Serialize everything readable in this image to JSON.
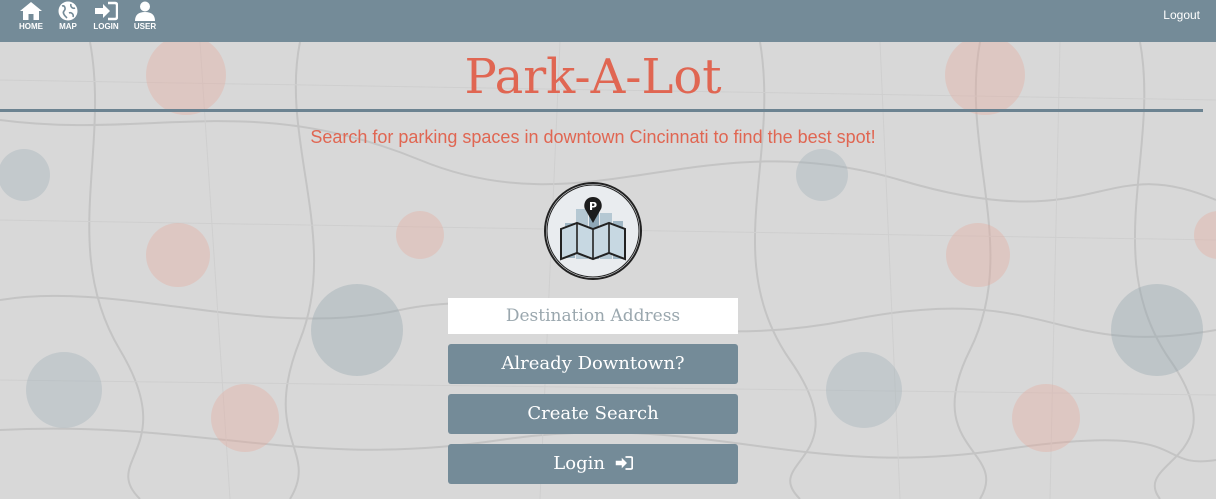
{
  "nav": {
    "items": [
      {
        "label": "HOME",
        "icon": "home-icon"
      },
      {
        "label": "MAP",
        "icon": "globe-icon"
      },
      {
        "label": "LOGIN",
        "icon": "sign-in-icon"
      },
      {
        "label": "USER",
        "icon": "user-icon"
      }
    ],
    "logout_label": "Logout"
  },
  "header": {
    "title": "Park-A-Lot",
    "subtitle": "Search for parking spaces in downtown Cincinnati to find the best spot!"
  },
  "form": {
    "destination_placeholder": "Destination Address",
    "destination_value": "",
    "already_downtown_label": "Already Downtown?",
    "create_search_label": "Create Search",
    "login_label": "Login"
  },
  "colors": {
    "nav_background": "#748b98",
    "accent": "#e06652",
    "button_background": "#748b98",
    "page_background": "#d8d8d8"
  }
}
